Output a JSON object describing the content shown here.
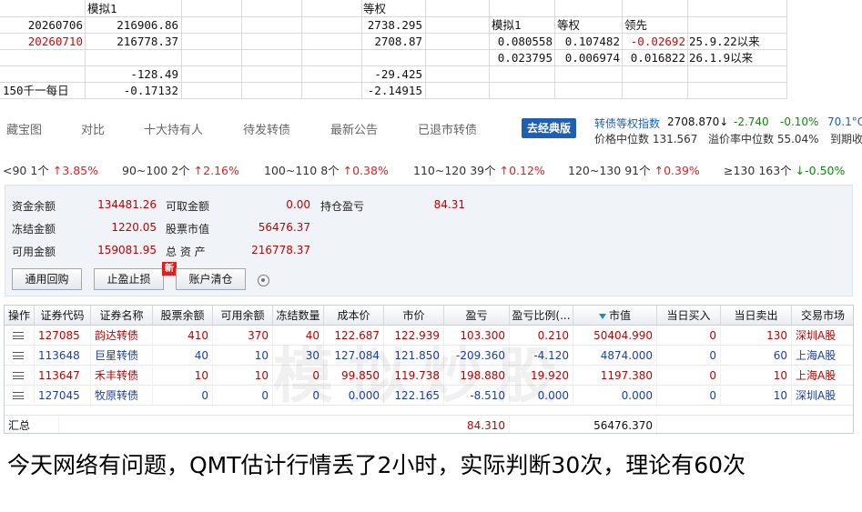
{
  "sheet": {
    "hdr_moni": "模拟1",
    "hdr_dengquan": "等权",
    "r1_date": "20260706",
    "r1_moni": "216906.86",
    "r1_dq": "2738.295",
    "r2_date": "20260710",
    "r2_moni": "216778.37",
    "r2_dq": "2708.87",
    "r3_moni": "-128.49",
    "r3_dq": "-29.425",
    "r4_label": "150千一每日",
    "r4_moni": "-0.17132",
    "r4_dq": "-2.14915",
    "cmp_h1": "模拟1",
    "cmp_h2": "等权",
    "cmp_h3": "领先",
    "cmp_a1": "0.080558",
    "cmp_a2": "0.107482",
    "cmp_a3": "-0.02692",
    "cmp_a4": "25.9.22以来",
    "cmp_b1": "0.023795",
    "cmp_b2": "0.006974",
    "cmp_b3": "0.016822",
    "cmp_b4": "26.1.9以来"
  },
  "nav": {
    "tabs": [
      "藏宝图",
      "对比",
      "十大持有人",
      "待发转债",
      "最新公告",
      "已退市转债"
    ],
    "classic_btn": "去经典版",
    "idx_label": "转债等权指数",
    "idx_value": "2708.870↓",
    "idx_change": "-2.740",
    "idx_pct": "-0.10%",
    "idx_temp": "70.1°C",
    "median_price": "价格中位数 131.567",
    "median_premium": "溢价率中位数 55.04%",
    "expiry": "到期收"
  },
  "bands": [
    {
      "range": "<90",
      "count": "1个",
      "arrow": "↑",
      "pct": "3.85%",
      "dir": "up"
    },
    {
      "range": "90~100",
      "count": "2个",
      "arrow": "↑",
      "pct": "2.16%",
      "dir": "up"
    },
    {
      "range": "100~110",
      "count": "8个",
      "arrow": "↑",
      "pct": "0.38%",
      "dir": "up"
    },
    {
      "range": "110~120",
      "count": "39个",
      "arrow": "↑",
      "pct": "0.12%",
      "dir": "up"
    },
    {
      "range": "120~130",
      "count": "91个",
      "arrow": "↑",
      "pct": "0.39%",
      "dir": "up"
    },
    {
      "range": "≥130",
      "count": "163个",
      "arrow": "↓",
      "pct": "-0.50%",
      "dir": "down"
    }
  ],
  "account": {
    "zjye_l": "资金余额",
    "zjye_v": "134481.26",
    "kqje_l": "可取金额",
    "kqje_v": "0.00",
    "ccyk_l": "持仓盈亏",
    "ccyk_v": "84.31",
    "djje_l": "冻结金额",
    "djje_v": "1220.05",
    "gpsz_l": "股票市值",
    "gpsz_v": "56476.37",
    "kyje_l": "可用金额",
    "kyje_v": "159081.95",
    "zzc_l": "总 资 产",
    "zzc_v": "216778.37",
    "btn_repo": "通用回购",
    "btn_stop": "止盈止损",
    "btn_clear": "账户清仓",
    "new_badge": "新"
  },
  "table": {
    "headers": [
      "操作",
      "证券代码",
      "证券名称",
      "股票余额",
      "可用余额",
      "冻结数量",
      "成本价",
      "市价",
      "盈亏",
      "盈亏比例(...",
      "市值",
      "当日买入",
      "当日卖出",
      "交易市场"
    ],
    "rows": [
      [
        "",
        "127085",
        "韵达转债",
        "410",
        "370",
        "40",
        "122.687",
        "122.939",
        "103.300",
        "0.210",
        "50404.990",
        "0",
        "130",
        "深圳A股"
      ],
      [
        "",
        "113648",
        "巨星转债",
        "40",
        "10",
        "30",
        "127.084",
        "121.850",
        "-209.360",
        "-4.120",
        "4874.000",
        "0",
        "60",
        "上海A股"
      ],
      [
        "",
        "113647",
        "禾丰转债",
        "10",
        "10",
        "0",
        "99.850",
        "119.738",
        "198.880",
        "19.920",
        "1197.380",
        "0",
        "10",
        "上海A股"
      ],
      [
        "",
        "127045",
        "牧原转债",
        "0",
        "0",
        "0",
        "0.000",
        "122.165",
        "-8.510",
        "0.000",
        "0.000",
        "0",
        "10",
        "深圳A股"
      ]
    ],
    "row_colors": [
      "#c00000",
      "#1a3fa8",
      "#c00000",
      "#1a3fa8"
    ],
    "sum_label": "汇总",
    "sum_pnl": "84.310",
    "sum_mv": "56476.370"
  },
  "watermark": "模拟炒股",
  "caption": "今天网络有问题，QMT估计行情丢了2小时，实际判断30次，理论有60次"
}
